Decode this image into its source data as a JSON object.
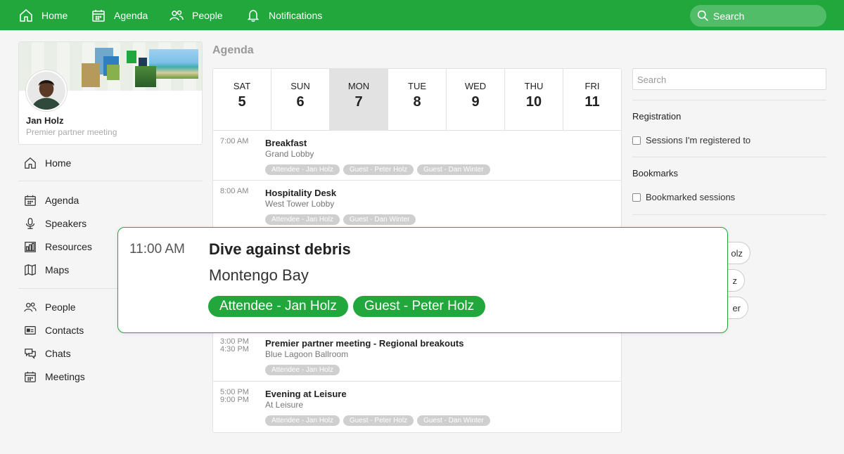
{
  "topnav": {
    "items": [
      {
        "label": "Home",
        "icon": "home-icon"
      },
      {
        "label": "Agenda",
        "icon": "calendar-icon"
      },
      {
        "label": "People",
        "icon": "people-icon"
      },
      {
        "label": "Notifications",
        "icon": "bell-icon"
      }
    ],
    "search_placeholder": "Search"
  },
  "profile": {
    "name": "Jan Holz",
    "subtitle": "Premier partner meeting"
  },
  "sidebar": {
    "items": [
      {
        "label": "Home",
        "icon": "home-icon"
      },
      {
        "label": "Agenda",
        "icon": "calendar-icon"
      },
      {
        "label": "Speakers",
        "icon": "microphone-icon"
      },
      {
        "label": "Resources",
        "icon": "resources-icon"
      },
      {
        "label": "Maps",
        "icon": "map-icon"
      },
      {
        "label": "People",
        "icon": "people-icon"
      },
      {
        "label": "Contacts",
        "icon": "contact-card-icon"
      },
      {
        "label": "Chats",
        "icon": "chat-icon"
      },
      {
        "label": "Meetings",
        "icon": "calendar-icon"
      }
    ]
  },
  "agenda": {
    "title": "Agenda",
    "days": [
      {
        "name": "SAT",
        "num": "5",
        "selected": false
      },
      {
        "name": "SUN",
        "num": "6",
        "selected": false
      },
      {
        "name": "MON",
        "num": "7",
        "selected": true
      },
      {
        "name": "TUE",
        "num": "8",
        "selected": false
      },
      {
        "name": "WED",
        "num": "9",
        "selected": false
      },
      {
        "name": "THU",
        "num": "10",
        "selected": false
      },
      {
        "name": "FRI",
        "num": "11",
        "selected": false
      }
    ],
    "sessions": [
      {
        "time": "7:00 AM",
        "end": "",
        "title": "Breakfast",
        "location": "Grand Lobby",
        "tags": [
          "Attendee - Jan Holz",
          "Guest - Peter Holz",
          "Guest - Dan Winter"
        ]
      },
      {
        "time": "8:00 AM",
        "end": "",
        "title": "Hospitality Desk",
        "location": "West Tower Lobby",
        "tags": [
          "Attendee - Jan Holz",
          "Guest - Dan Winter"
        ]
      },
      {
        "time": "3:00 PM",
        "end": "4:30 PM",
        "title": "Premier partner meeting - Regional breakouts",
        "location": "Blue Lagoon Ballroom",
        "tags": [
          "Attendee - Jan Holz"
        ]
      },
      {
        "time": "5:00 PM",
        "end": "9:00 PM",
        "title": "Evening at Leisure",
        "location": "At Leisure",
        "tags": [
          "Attendee - Jan Holz",
          "Guest - Peter Holz",
          "Guest - Dan Winter"
        ]
      }
    ]
  },
  "filters": {
    "search_placeholder": "Search",
    "registration_heading": "Registration",
    "registration_option": "Sessions I'm registered to",
    "bookmarks_heading": "Bookmarks",
    "bookmarks_option": "Bookmarked sessions",
    "partial_pills": [
      "olz",
      "z",
      "er"
    ]
  },
  "popup": {
    "time": "11:00 AM",
    "title": "Dive against debris",
    "location": "Montengo Bay",
    "tags": [
      "Attendee - Jan Holz",
      "Guest - Peter Holz"
    ]
  },
  "colors": {
    "brand_green": "#21a73c",
    "tag_gray": "#cfcfcf",
    "selected_day": "#e2e2e2"
  }
}
